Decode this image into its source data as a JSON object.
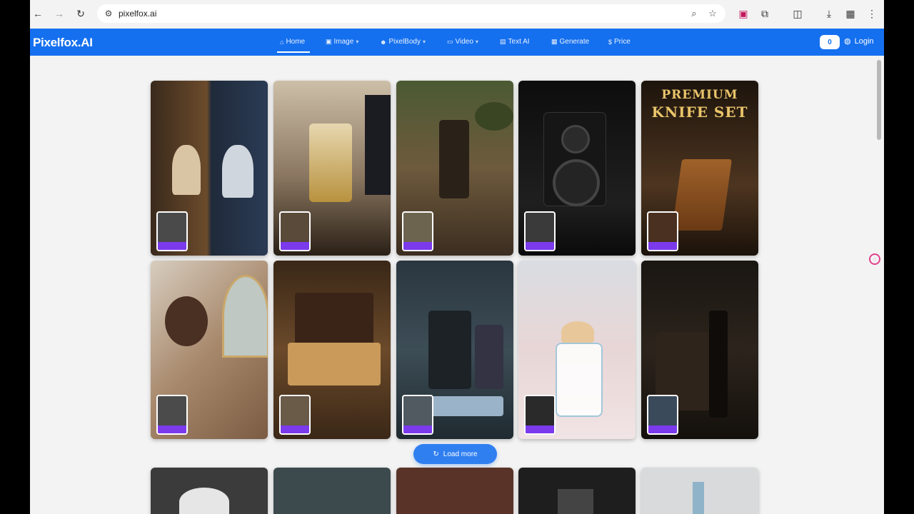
{
  "browser": {
    "url": "pixelfox.ai",
    "icons": [
      "back-icon",
      "forward-icon",
      "reload-icon",
      "site-info-icon",
      "zoom-icon",
      "star-icon",
      "extension-icon",
      "puzzle-icon",
      "split-view-icon",
      "download-icon",
      "sidebar-icon",
      "menu-icon"
    ]
  },
  "site": {
    "logo": "Pixelfox.AI",
    "menu": [
      {
        "label": "Home",
        "icon": "⌂",
        "dropdown": false
      },
      {
        "label": "Image",
        "icon": "▣",
        "dropdown": true
      },
      {
        "label": "PixelBody",
        "icon": "☻",
        "dropdown": true
      },
      {
        "label": "Video",
        "icon": "▭",
        "dropdown": true
      },
      {
        "label": "Text AI",
        "icon": "▤",
        "dropdown": false
      },
      {
        "label": "Generate",
        "icon": "▦",
        "dropdown": false
      },
      {
        "label": "Price",
        "icon": "$",
        "dropdown": false
      }
    ],
    "credits": "0",
    "login": "Login",
    "accent": "#1570ef"
  },
  "gallery": {
    "premium_lines": [
      "PREMIUM",
      "KNIFE SET"
    ],
    "load_more": "Load more"
  }
}
